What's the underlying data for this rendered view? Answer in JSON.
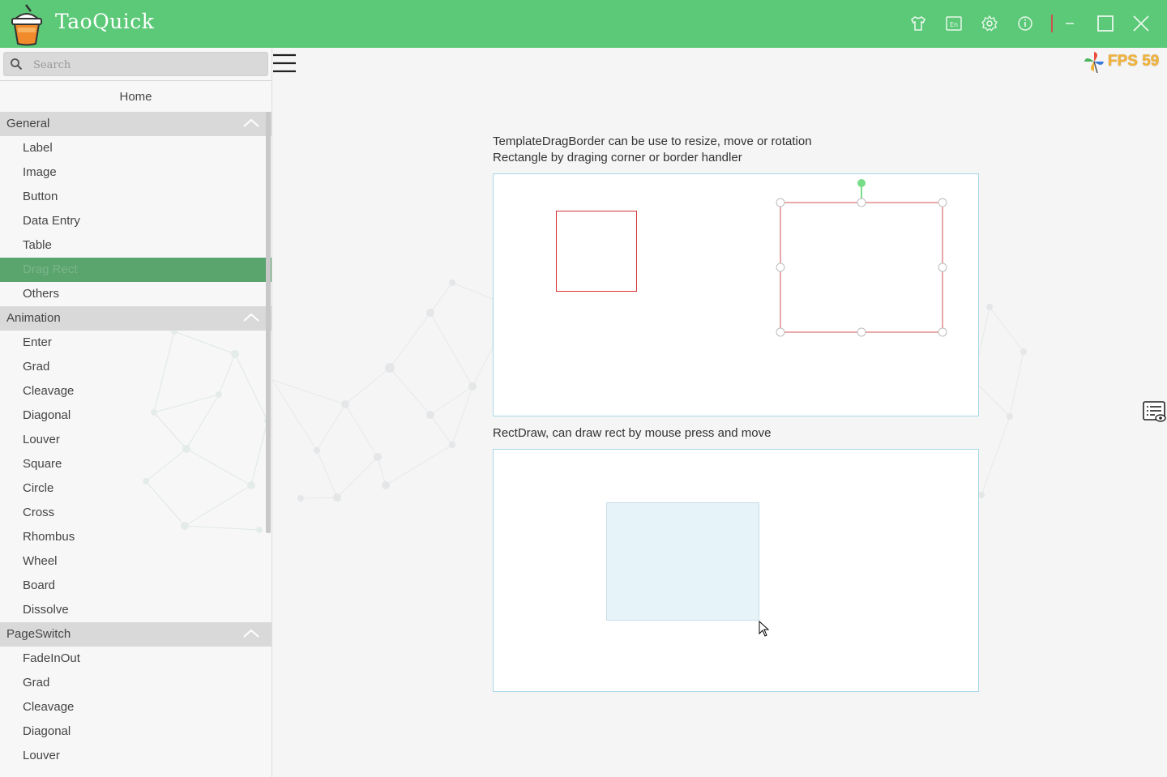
{
  "app": {
    "title": "TaoQuick"
  },
  "toolbar": {
    "icons": [
      "skin-icon",
      "language-icon",
      "settings-icon",
      "info-icon",
      "minimize-icon",
      "maximize-icon",
      "close-icon"
    ],
    "language_glyph": "En"
  },
  "colors": {
    "titlebar": "#5bc977",
    "active_item": "#5aa46e",
    "rotate_handle": "#77dd88",
    "drag_border": "#d43333",
    "panel_border": "#a8d8e8",
    "draw_fill": "#e6f3f8"
  },
  "sidebar": {
    "search_placeholder": "Search",
    "home_label": "Home",
    "groups": [
      {
        "title": "General",
        "items": [
          "Label",
          "Image",
          "Button",
          "Data Entry",
          "Table",
          "Drag Rect",
          "Others"
        ]
      },
      {
        "title": "Animation",
        "items": [
          "Enter",
          "Grad",
          "Cleavage",
          "Diagonal",
          "Louver",
          "Square",
          "Circle",
          "Cross",
          "Rhombus",
          "Wheel",
          "Board",
          "Dissolve"
        ]
      },
      {
        "title": "PageSwitch",
        "items": [
          "FadeInOut",
          "Grad",
          "Cleavage",
          "Diagonal",
          "Louver"
        ]
      }
    ],
    "active_item": "Drag Rect"
  },
  "main": {
    "fps_label": "FPS 59",
    "drag_desc_line1": "TemplateDragBorder can be use to resize, move or rotation",
    "drag_desc_line2": "Rectangle by draging corner or border handler",
    "draw_desc": "RectDraw, can draw rect by mouse press and move"
  }
}
